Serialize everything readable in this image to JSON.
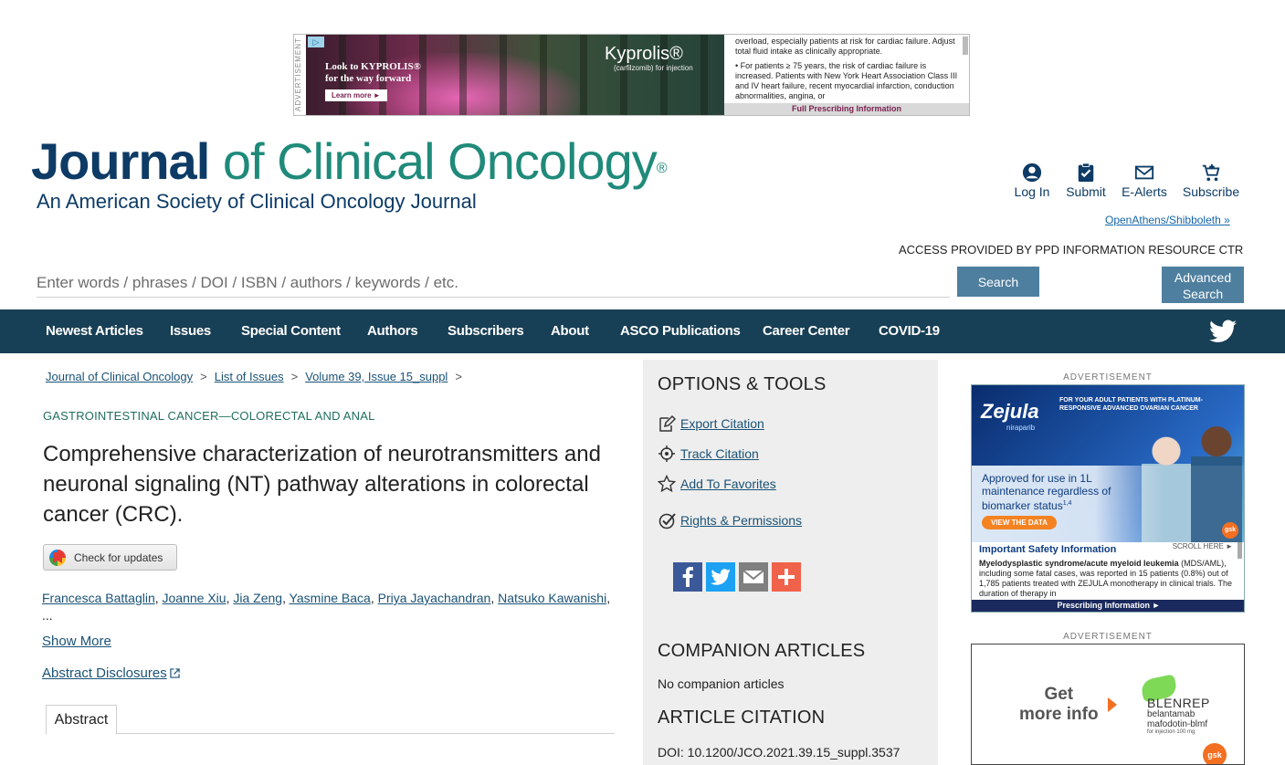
{
  "top_ad": {
    "vertical_label": "ADVERTISEMENT",
    "headline_line1": "Look to KYPROLIS®",
    "headline_line2": "for the way forward",
    "button": "Learn more ►",
    "brand": "Kyprolis®",
    "brand_sub": "(carfilzomib) for injection",
    "isi_1": "overload, especially patients at risk for cardiac failure. Adjust total fluid intake as clinically appropriate.",
    "isi_2": "• For patients ≥ 75 years, the risk of cardiac failure is increased. Patients with New York Heart Association Class III and IV heart failure, recent myocardial infarction, conduction abnormalities, angina, or",
    "isi_link": "Full Prescribing Information"
  },
  "logo": {
    "journal": "Journal",
    "rest": " of Clinical Oncology",
    "reg": "®",
    "subtitle": "An American Society of Clinical Oncology Journal"
  },
  "user_nav": {
    "login": "Log In",
    "submit": "Submit",
    "ealerts": "E-Alerts",
    "subscribe": "Subscribe",
    "openathens": "OpenAthens/Shibboleth »",
    "access": "ACCESS PROVIDED BY PPD INFORMATION RESOURCE CTR"
  },
  "search": {
    "placeholder": "Enter words / phrases / DOI / ISBN / authors / keywords / etc.",
    "button": "Search",
    "advanced_line1": "Advanced",
    "advanced_line2": "Search"
  },
  "main_nav": {
    "items": [
      "Newest Articles",
      "Issues",
      "Special Content",
      "Authors",
      "Subscribers",
      "About",
      "ASCO Publications",
      "Career Center",
      "COVID-19"
    ]
  },
  "breadcrumb": {
    "items": [
      "Journal of Clinical Oncology",
      "List of Issues",
      "Volume 39, Issue 15_suppl"
    ],
    "sep": ">"
  },
  "article": {
    "section": "GASTROINTESTINAL CANCER—COLORECTAL AND ANAL",
    "title": "Comprehensive characterization of neurotransmitters and neuronal signaling (NT) pathway alterations in colorectal cancer (CRC).",
    "check_updates": "Check for updates",
    "authors": [
      "Francesca Battaglin",
      "Joanne Xiu",
      "Jia Zeng",
      "Yasmine Baca",
      "Priya Jayachandran",
      "Natsuko Kawanishi"
    ],
    "ellipsis": "...",
    "show_more": "Show More",
    "abstract_disclosures": "Abstract Disclosures",
    "tab_abstract": "Abstract"
  },
  "options": {
    "heading": "OPTIONS & TOOLS",
    "export": "Export Citation",
    "track": "Track Citation",
    "favorites": "Add To Favorites",
    "rights": "Rights & Permissions",
    "companion_heading": "COMPANION ARTICLES",
    "companion_none": "No companion articles",
    "citation_heading": "ARTICLE CITATION",
    "doi": "DOI: 10.1200/JCO.2021.39.15_suppl.3537"
  },
  "right_ads": {
    "label": "ADVERTISEMENT",
    "zejula": {
      "logo": "Zejula",
      "logo_sub": "niraparib",
      "headline": "FOR YOUR ADULT PATIENTS WITH PLATINUM-RESPONSIVE ADVANCED OVARIAN CANCER",
      "approved": "Approved for use in 1L maintenance regardless of biomarker status",
      "approved_sup": "1,4",
      "button": "VIEW THE DATA",
      "gsk": "gsk",
      "isi_heading": "Important Safety Information",
      "scroll": "SCROLL HERE ►",
      "isi_bold": "Myelodysplastic syndrome/acute myeloid leukemia",
      "isi_text": "(MDS/AML), including some fatal cases, was reported in 15 patients (0.8%) out of 1,785 patients treated with ZEJULA monotherapy in clinical trials. The duration of therapy in",
      "bar": "Prescribing Information ►"
    },
    "blenrep": {
      "get_line1": "Get",
      "get_line2": "more info",
      "name": "BLENREP",
      "sub_line1": "belantamab",
      "sub_line2": "mafodotin-blmf",
      "small": "for injection 100 mg",
      "gsk": "gsk"
    }
  },
  "colors": {
    "nav_bg": "#173f55",
    "logo_navy": "#0d3b66",
    "logo_teal": "#1f8a7a",
    "button": "#4f7f9f",
    "link": "#1a5276",
    "panel_bg": "#eeeeee"
  },
  "icons": {
    "login": "user-circle-icon",
    "submit": "clipboard-check-icon",
    "ealerts": "envelope-icon",
    "subscribe": "cart-icon",
    "twitter": "twitter-bird-icon",
    "export": "edit-icon",
    "track": "target-icon",
    "favorites": "star-icon",
    "rights": "check-circle-icon",
    "share": [
      "facebook-icon",
      "twitter-icon",
      "email-icon",
      "plus-icon"
    ]
  }
}
